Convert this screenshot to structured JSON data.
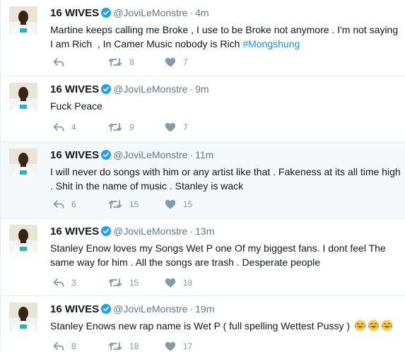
{
  "colors": {
    "name": "#14171a",
    "muted": "#657786",
    "verified": "#1da1f2",
    "hashtag": "#1b95e0",
    "action": "#8899a6",
    "highlight_bg": "#f5f8fa",
    "divider": "#e6ecf0"
  },
  "icons": {
    "reply": "reply-arrow-icon",
    "retweet": "retweet-icon",
    "like": "heart-icon",
    "verified": "verified-badge-icon",
    "emoji": "face-with-tears-of-joy-emoji"
  },
  "tweets": [
    {
      "name": "16 WIVES",
      "handle": "@JoviLeMonstre",
      "separator": "·",
      "time": "4m",
      "text": "Martine keeps calling me Broke , I use to be Broke not anymore . I'm not saying",
      "text_line2": "I am Rich  , In Camer Music nobody is Rich ",
      "hashtag": "#Mongshung",
      "emoji_count": 0,
      "replies": "",
      "retweets": "8",
      "likes": "7",
      "highlighted": false
    },
    {
      "name": "16 WIVES",
      "handle": "@JoviLeMonstre",
      "separator": "·",
      "time": "9m",
      "text": "Fuck Peace",
      "text_line2": "",
      "hashtag": "",
      "emoji_count": 0,
      "replies": "4",
      "retweets": "9",
      "likes": "7",
      "highlighted": false
    },
    {
      "name": "16 WIVES",
      "handle": "@JoviLeMonstre",
      "separator": "·",
      "time": "11m",
      "text": "I will never do songs with him or any artist like that . Fakeness at its all time high",
      "text_line2": ". Shit in the name of music . Stanley is wack",
      "hashtag": "",
      "emoji_count": 0,
      "replies": "6",
      "retweets": "15",
      "likes": "15",
      "highlighted": true
    },
    {
      "name": "16 WIVES",
      "handle": "@JoviLeMonstre",
      "separator": "·",
      "time": "13m",
      "text": "Stanley Enow loves my Songs Wet P one Of my biggest fans. I dont feel The",
      "text_line2": "same way for him . All the songs are trash . Desperate people",
      "hashtag": "",
      "emoji_count": 0,
      "replies": "3",
      "retweets": "15",
      "likes": "18",
      "highlighted": false
    },
    {
      "name": "16 WIVES",
      "handle": "@JoviLeMonstre",
      "separator": "·",
      "time": "19m",
      "text": "Stanley Enows new rap name is Wet P ( full spelling Wettest Pussy )",
      "text_line2": "",
      "hashtag": "",
      "emoji_count": 3,
      "replies": "8",
      "retweets": "18",
      "likes": "17",
      "highlighted": false
    }
  ]
}
